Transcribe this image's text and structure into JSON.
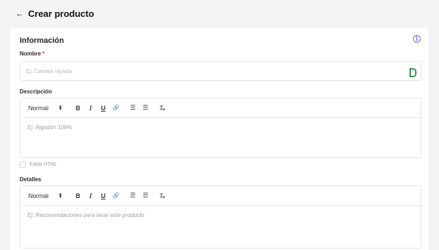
{
  "header": {
    "back_arrow": "←",
    "title": "Crear producto"
  },
  "card": {
    "section_title": "Información",
    "info_icon": "info-icon"
  },
  "name_field": {
    "label": "Nombre",
    "required_mark": "*",
    "placeholder": "Ej: Camisa rayada",
    "side_icon": "grammar-check-icon"
  },
  "description": {
    "label": "Descripción",
    "toolbar": {
      "format": "Normal",
      "bold": "B",
      "italic": "I",
      "underline": "U",
      "link": "🔗",
      "ordered_list": "☰",
      "bullet_list": "☰",
      "clear_format": "T̶ₓ"
    },
    "placeholder": "Ej: Algodón 100%"
  },
  "edit_html": {
    "label": "Editar HTML",
    "checked": false
  },
  "details": {
    "label": "Detalles",
    "toolbar": {
      "format": "Normal",
      "bold": "B",
      "italic": "I",
      "underline": "U",
      "link": "🔗",
      "ordered_list": "☰",
      "bullet_list": "☰",
      "clear_format": "T̶ₓ"
    },
    "placeholder": "Ej: Recomendaciones para lavar este producto"
  }
}
